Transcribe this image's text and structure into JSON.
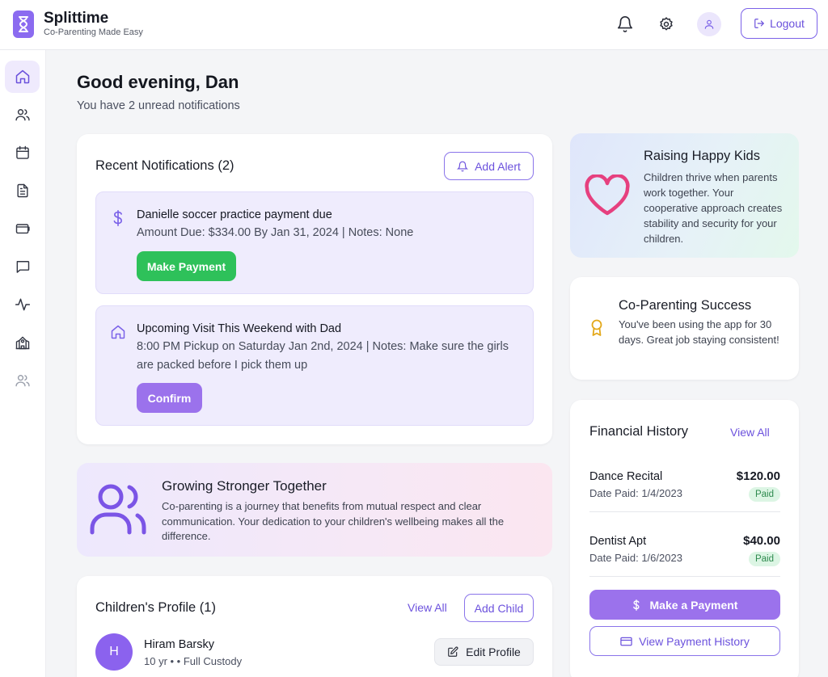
{
  "app": {
    "name": "Splittime",
    "tagline": "Co-Parenting Made Easy"
  },
  "header": {
    "logout_label": "Logout"
  },
  "sidebar": {
    "items": [
      "home",
      "contacts",
      "calendar",
      "documents",
      "payments",
      "messages",
      "activity",
      "schools",
      "family"
    ]
  },
  "greeting": {
    "title": "Good evening, Dan",
    "subtitle": "You have 2 unread notifications"
  },
  "notifications": {
    "title": "Recent Notifications (2)",
    "add_alert_label": "Add Alert",
    "items": [
      {
        "title": "Danielle soccer practice payment due",
        "body": "Amount Due: $334.00 By Jan 31, 2024 | Notes: None",
        "action": "Make Payment"
      },
      {
        "title": "Upcoming Visit This Weekend with Dad",
        "body": "8:00 PM Pickup on Saturday Jan 2nd, 2024 | Notes: Make sure the girls are packed before I pick them up",
        "action": "Confirm"
      }
    ]
  },
  "growing": {
    "title": "Growing Stronger Together",
    "body": "Co-parenting is a journey that benefits from mutual respect and clear communication. Your dedication to your children's wellbeing makes all the difference."
  },
  "children": {
    "title": "Children's Profile (1)",
    "view_all_label": "View All",
    "add_child_label": "Add Child",
    "child": {
      "initial": "H",
      "name": "Hiram Barsky",
      "details": "10 yr • • Full Custody",
      "edit_label": "Edit Profile"
    }
  },
  "happy_kids": {
    "title": "Raising Happy Kids",
    "body": "Children thrive when parents work together. Your cooperative approach creates stability and security for your children."
  },
  "success": {
    "title": "Co-Parenting Success",
    "body": "You've been using the app for 30 days. Great job staying consistent!"
  },
  "financial": {
    "title": "Financial History",
    "view_all_label": "View All",
    "rows": [
      {
        "title": "Dance Recital",
        "date": "Date Paid: 1/4/2023",
        "amount": "$120.00",
        "status": "Paid"
      },
      {
        "title": "Dentist Apt",
        "date": "Date Paid: 1/6/2023",
        "amount": "$40.00",
        "status": "Paid"
      }
    ],
    "make_payment_label": "Make a Payment",
    "history_label": "View Payment History"
  },
  "colors": {
    "accent": "#8b6bf0",
    "green": "#2ec15a",
    "purple_btn": "#9b72ec",
    "pink": "#e6407f",
    "gold": "#e3a81a"
  }
}
